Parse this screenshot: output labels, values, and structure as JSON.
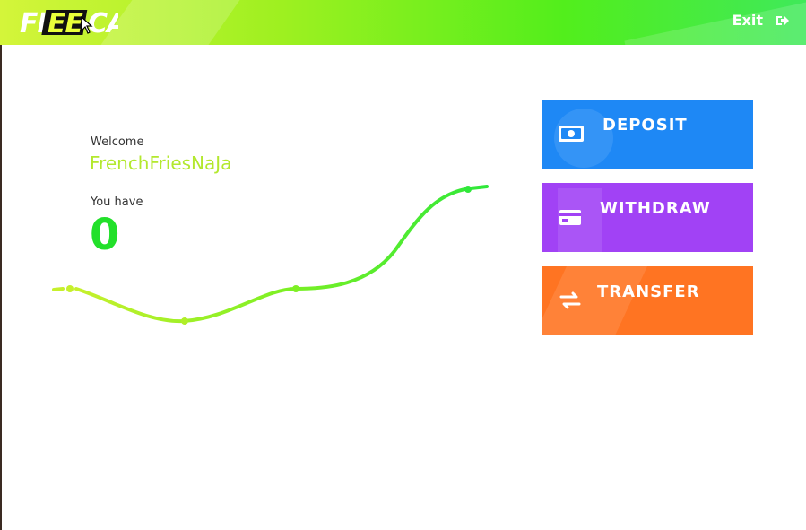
{
  "header": {
    "logo": "FLEECA",
    "exit_label": "Exit"
  },
  "account": {
    "welcome_label": "Welcome",
    "username": "FrenchFriesNaJa",
    "balance_label": "You have",
    "balance": "0"
  },
  "actions": [
    {
      "label": "DEPOSIT",
      "icon": "cash-icon",
      "color": "#1e88f5"
    },
    {
      "label": "WITHDRAW",
      "icon": "card-icon",
      "color": "#a142f5"
    },
    {
      "label": "TRANSFER",
      "icon": "transfer-icon",
      "color": "#ff7422"
    }
  ],
  "colors": {
    "header_start": "#d4f53a",
    "header_end": "#3fe95a",
    "username": "#b3e82e",
    "balance": "#22e02a"
  }
}
